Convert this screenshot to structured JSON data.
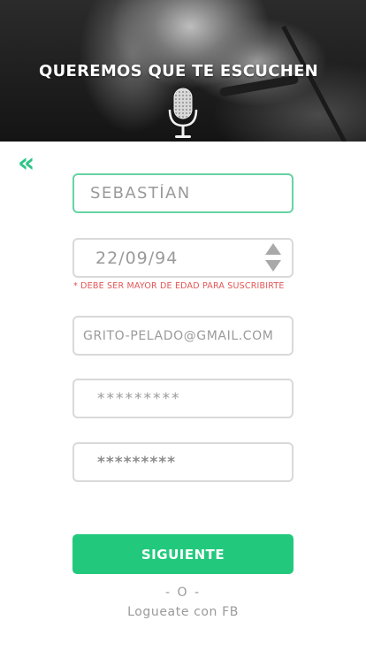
{
  "header": {
    "title": "QUEREMOS QUE TE ESCUCHEN",
    "mic_icon": "microphone-icon"
  },
  "nav": {
    "back_label": "«",
    "back_icon": "double-chevron-left-icon"
  },
  "form": {
    "name_value": "SEBASTÍAN",
    "birthdate_value": "22/09/94",
    "age_notice": "* DEBE SER MAYOR DE EDAD PARA SUSCRIBIRTE",
    "email_value": "GRITO-PELADO@GMAIL.COM",
    "password_value": "*********",
    "password_confirm_value": "*********"
  },
  "actions": {
    "next_label": "SIGUIENTE",
    "divider": "- O -",
    "fb_login": "Logueate con FB"
  },
  "colors": {
    "accent": "#22c97d",
    "warning": "#e25555",
    "active_border": "#66d3a4"
  }
}
